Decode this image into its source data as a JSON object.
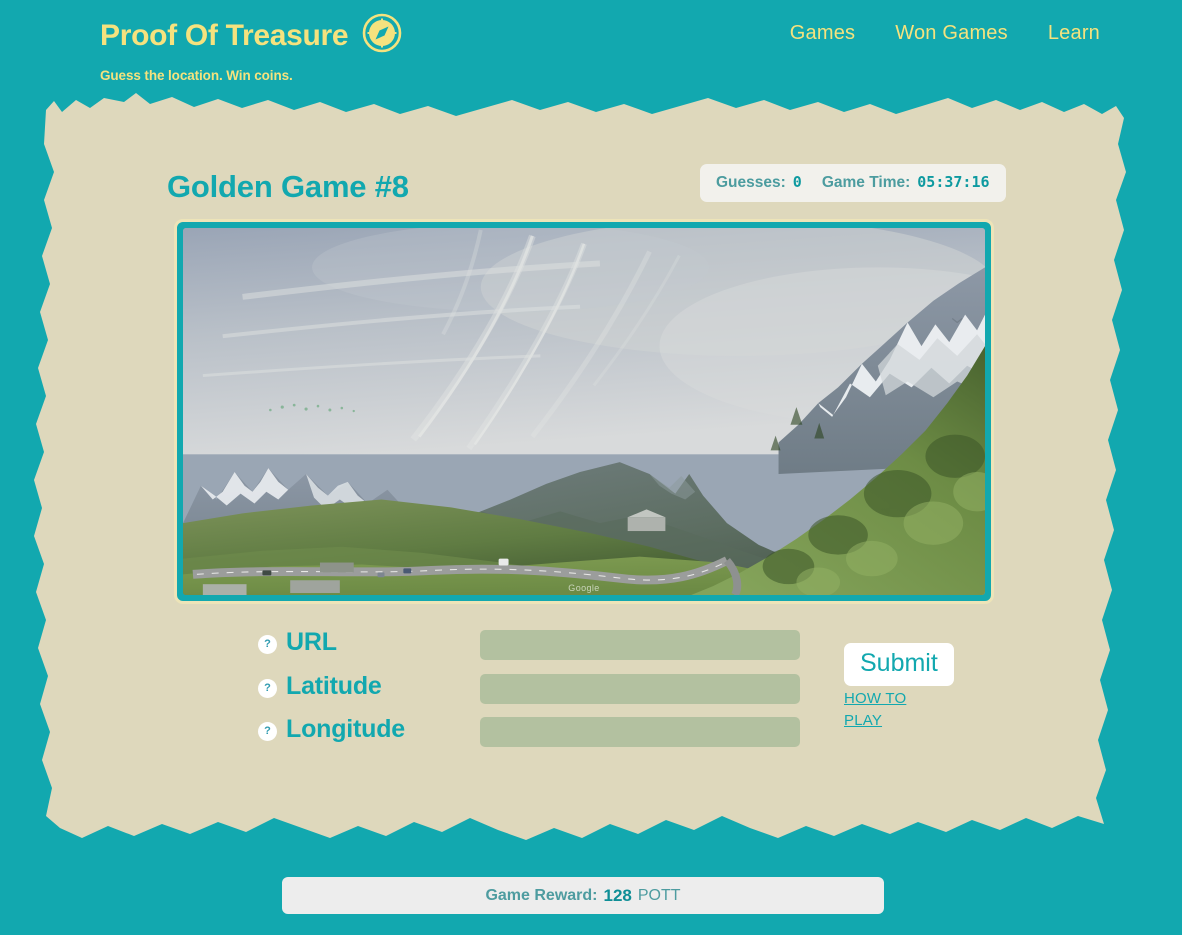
{
  "brand": {
    "title": "Proof Of Treasure",
    "tagline": "Guess the location. Win coins.",
    "logo_icon": "compass-icon",
    "logo_color": "#F5E27E"
  },
  "nav": {
    "items": [
      {
        "label": "Games"
      },
      {
        "label": "Won Games"
      },
      {
        "label": "Learn"
      }
    ]
  },
  "game": {
    "title": "Golden Game #8",
    "status": {
      "guesses_label": "Guesses:",
      "guesses_value": "0",
      "time_label": "Game Time:",
      "time_value": "05:37:16"
    },
    "photo": {
      "watermark": "Google",
      "alt": "Alpine mountain valley with winding road, snow-capped peaks and contrails"
    }
  },
  "form": {
    "fields": [
      {
        "help": "?",
        "label": "URL",
        "value": "",
        "placeholder": ""
      },
      {
        "help": "?",
        "label": "Latitude",
        "value": "",
        "placeholder": ""
      },
      {
        "help": "?",
        "label": "Longitude",
        "value": "",
        "placeholder": ""
      }
    ],
    "submit_label": "Submit",
    "howto_label": "HOW TO PLAY"
  },
  "reward": {
    "label": "Game Reward:",
    "amount": "128",
    "unit": "POTT"
  },
  "colors": {
    "background_teal": "#12A8AF",
    "paper_beige": "#DED8BC",
    "accent_yellow": "#F5E27E",
    "input_sage": "#B3C1A0",
    "panel_gray": "#EDEDED"
  }
}
